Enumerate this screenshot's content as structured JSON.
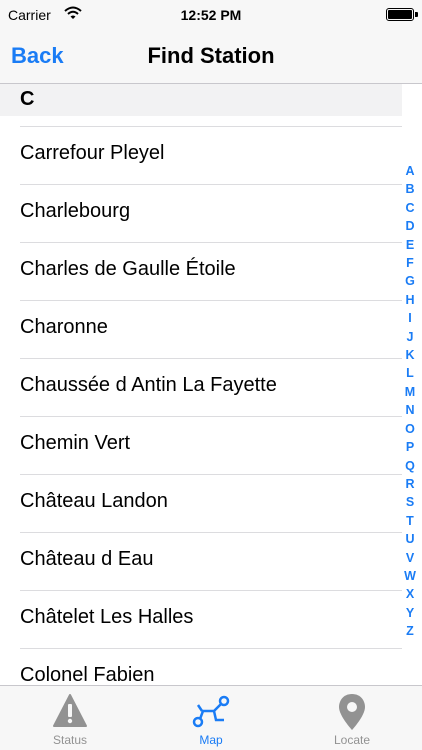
{
  "status_bar": {
    "carrier": "Carrier",
    "time": "12:52 PM"
  },
  "nav": {
    "back_label": "Back",
    "title": "Find Station"
  },
  "section": {
    "letter": "C"
  },
  "stations": [
    "Carrefour Pleyel",
    "Charlebourg",
    "Charles de Gaulle Étoile",
    "Charonne",
    "Chaussée d Antin La Fayette",
    "Chemin Vert",
    "Château Landon",
    "Château d Eau",
    "Châtelet Les Halles",
    "Colonel Fabien"
  ],
  "index_letters": [
    "A",
    "B",
    "C",
    "D",
    "E",
    "F",
    "G",
    "H",
    "I",
    "J",
    "K",
    "L",
    "M",
    "N",
    "O",
    "P",
    "Q",
    "R",
    "S",
    "T",
    "U",
    "V",
    "W",
    "X",
    "Y",
    "Z"
  ],
  "tabs": [
    {
      "label": "Status",
      "icon": "warning-icon",
      "active": false
    },
    {
      "label": "Map",
      "icon": "route-map-icon",
      "active": true
    },
    {
      "label": "Locate",
      "icon": "location-pin-icon",
      "active": false
    }
  ],
  "colors": {
    "accent": "#1a7cf5",
    "inactive": "#929292"
  }
}
